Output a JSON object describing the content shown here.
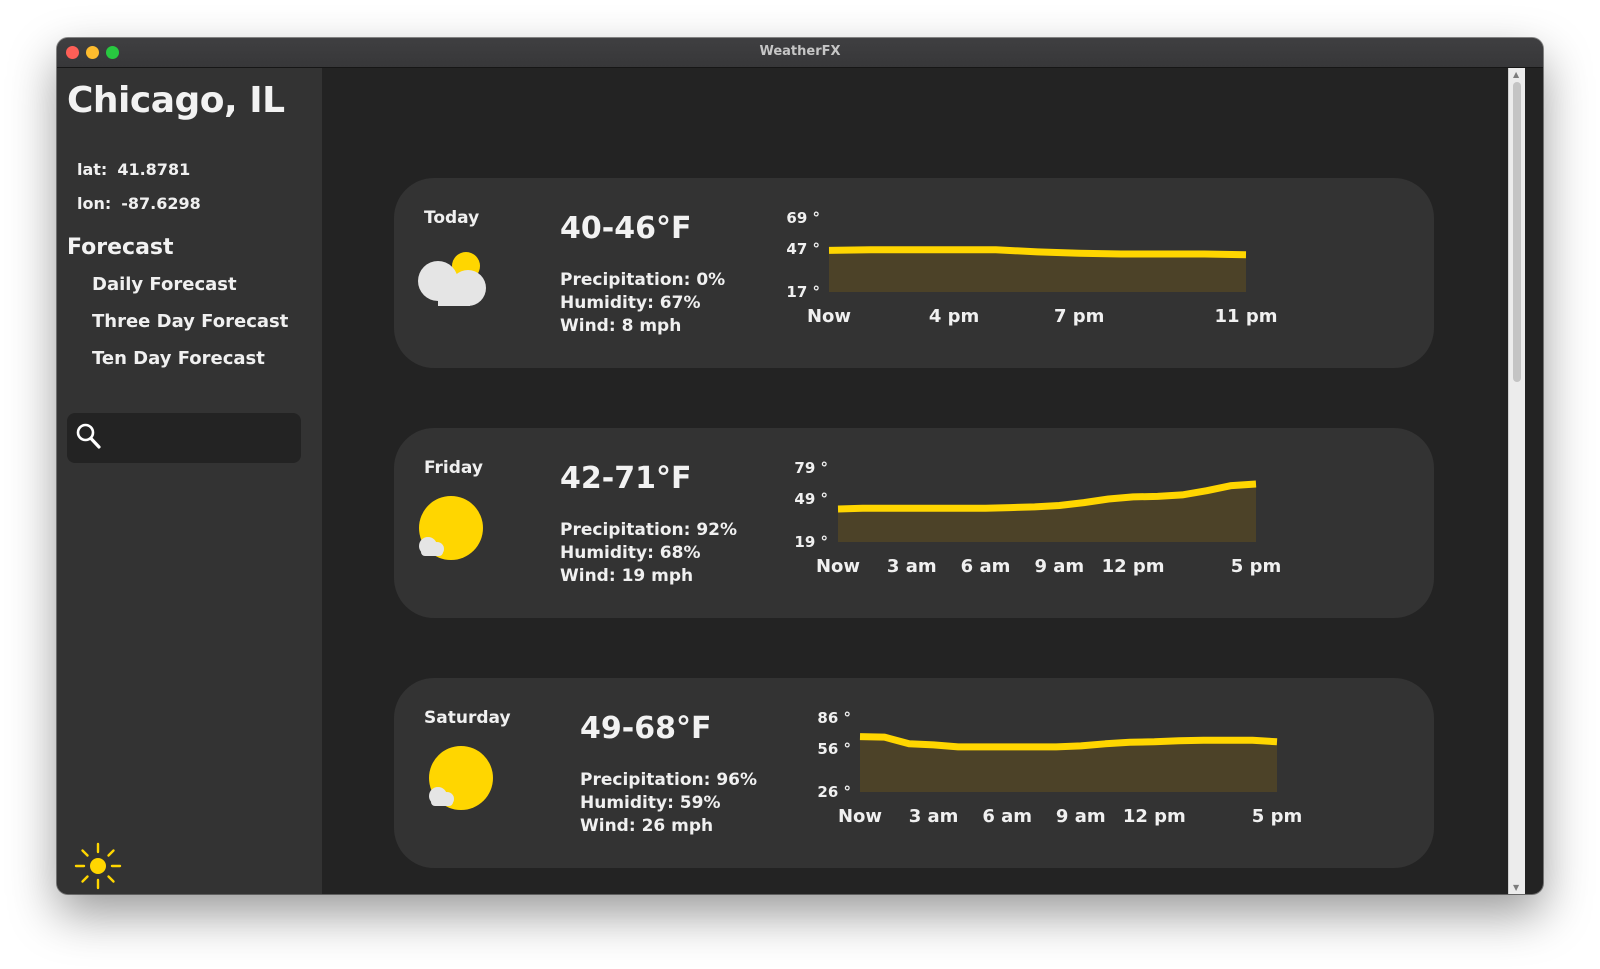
{
  "window": {
    "title": "WeatherFX"
  },
  "sidebar": {
    "city": "Chicago, IL",
    "lat_label": "lat:",
    "lat_value": "41.8781",
    "lon_label": "lon:",
    "lon_value": "-87.6298",
    "forecast_heading": "Forecast",
    "nav": [
      "Daily Forecast",
      "Three Day Forecast",
      "Ten Day Forecast"
    ],
    "search_placeholder": "",
    "theme_icon": "sun-icon"
  },
  "colors": {
    "accent": "#FFD600",
    "card_bg": "#333333",
    "main_bg": "#232323",
    "sidebar_bg": "#333333",
    "fill": "#4C4228"
  },
  "cards": [
    {
      "day": "Today",
      "icon": "partly-cloudy-icon",
      "range": "40-46°F",
      "precipitation": "Precipitation: 0%",
      "humidity": "Humidity: 67%",
      "wind": "Wind: 8 mph"
    },
    {
      "day": "Friday",
      "icon": "sunny-icon",
      "range": "42-71°F",
      "precipitation": "Precipitation: 92%",
      "humidity": "Humidity: 68%",
      "wind": "Wind: 19 mph"
    },
    {
      "day": "Saturday",
      "icon": "sunny-icon",
      "range": "49-68°F",
      "precipitation": "Precipitation: 96%",
      "humidity": "Humidity: 59%",
      "wind": "Wind: 26 mph"
    }
  ],
  "chart_data": [
    {
      "type": "area",
      "y_ticks": [
        "69 °",
        "47 °",
        "17 °"
      ],
      "x_tick_labels": [
        "Now",
        "4 pm",
        "7 pm",
        "11 pm"
      ],
      "x_ticks": [
        0,
        3,
        6,
        10
      ],
      "x": [
        0,
        1,
        2,
        3,
        4,
        5,
        6,
        7,
        8,
        9,
        10
      ],
      "y": [
        46,
        46.5,
        46.5,
        46.5,
        46.5,
        45,
        44,
        43.5,
        43.5,
        43.5,
        43
      ],
      "ylim": [
        17,
        69
      ],
      "y_ref": [
        17,
        47,
        69
      ]
    },
    {
      "type": "area",
      "y_ticks": [
        "79 °",
        "49 °",
        "19 °"
      ],
      "x_tick_labels": [
        "Now",
        "3 am",
        "6 am",
        "9 am",
        "12 pm",
        "5 pm"
      ],
      "x_ticks": [
        0,
        3,
        6,
        9,
        12,
        17
      ],
      "x": [
        0,
        1,
        2,
        3,
        4,
        5,
        6,
        7,
        8,
        9,
        10,
        11,
        12,
        13,
        14,
        15,
        16,
        17
      ],
      "y": [
        42,
        42.5,
        42.5,
        42.5,
        42.5,
        42.5,
        42.5,
        43,
        43.5,
        44.5,
        46.5,
        49,
        51,
        51.5,
        53,
        57,
        62,
        63.5
      ],
      "ylim": [
        19,
        79
      ],
      "y_ref": [
        19,
        49,
        79
      ]
    },
    {
      "type": "area",
      "y_ticks": [
        "86 °",
        "56 °",
        "26 °"
      ],
      "x_tick_labels": [
        "Now",
        "3 am",
        "6 am",
        "9 am",
        "12 pm",
        "5 pm"
      ],
      "x_ticks": [
        0,
        3,
        6,
        9,
        12,
        17
      ],
      "x": [
        0,
        1,
        2,
        3,
        4,
        5,
        6,
        7,
        8,
        9,
        10,
        11,
        12,
        13,
        14,
        15,
        16,
        17
      ],
      "y": [
        68,
        67.5,
        61,
        60,
        58,
        58,
        58,
        58,
        58,
        59,
        61,
        62.5,
        63,
        64,
        64.5,
        64.5,
        64.5,
        63
      ],
      "ylim": [
        26,
        86
      ],
      "y_ref": [
        26,
        56,
        86
      ]
    }
  ]
}
